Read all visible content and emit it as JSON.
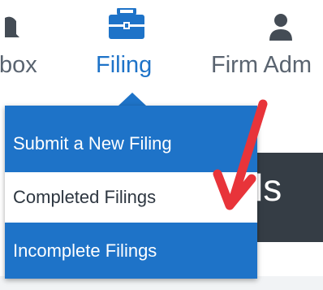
{
  "nav": {
    "items": [
      {
        "label": "box",
        "icon": "bell-icon"
      },
      {
        "label": "Filing",
        "icon": "briefcase-icon",
        "active": true
      },
      {
        "label": "Firm Adm",
        "icon": "user-icon"
      }
    ]
  },
  "dropdown": {
    "items": [
      {
        "label": "Submit a New Filing"
      },
      {
        "label": "Completed Filings",
        "highlighted": true
      },
      {
        "label": "Incomplete Filings"
      }
    ]
  },
  "background": {
    "heading_fragment": "ls"
  },
  "annotation": {
    "type": "arrow",
    "color": "#e8343a",
    "points_to": "Completed Filings"
  },
  "colors": {
    "accent": "#1e73c8",
    "nav_text": "#5a6470",
    "dark_panel": "#353d45",
    "annotation": "#e8343a"
  }
}
